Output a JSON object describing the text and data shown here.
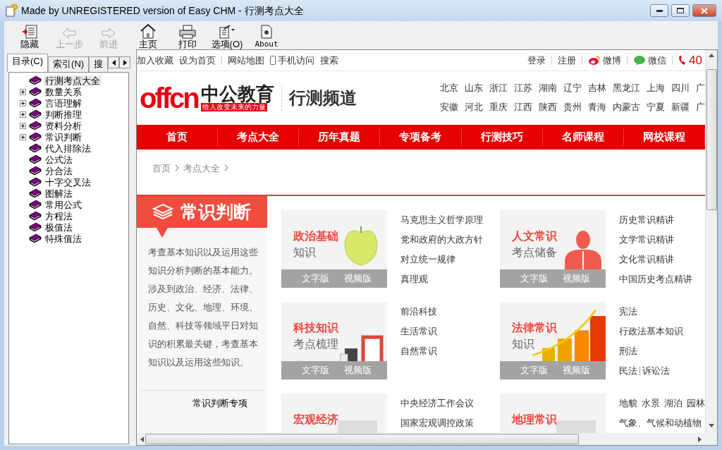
{
  "window": {
    "title": "Made by UNREGISTERED version of Easy CHM - 行测考点大全"
  },
  "toolbar": [
    {
      "label": "隐藏",
      "kind": "hide",
      "disabled": false
    },
    {
      "label": "上一步",
      "kind": "back",
      "disabled": true
    },
    {
      "label": "前进",
      "kind": "forward",
      "disabled": true
    },
    {
      "label": "主页",
      "kind": "home",
      "disabled": false
    },
    {
      "label": "打印",
      "kind": "print",
      "disabled": false
    },
    {
      "label": "选项(O)",
      "kind": "options",
      "disabled": false
    },
    {
      "label": "About",
      "kind": "about",
      "disabled": false
    }
  ],
  "nav_tabs": [
    {
      "label": "目录(C)",
      "selected": true
    },
    {
      "label": "索引(N)",
      "selected": false
    },
    {
      "label": "搜",
      "selected": false
    }
  ],
  "tree": [
    {
      "label": "行测考点大全",
      "kind": "page",
      "selected": true
    },
    {
      "label": "数量关系",
      "kind": "folder",
      "expanded": false,
      "selected": false
    },
    {
      "label": "言语理解",
      "kind": "folder",
      "expanded": false,
      "selected": false
    },
    {
      "label": "判断推理",
      "kind": "folder",
      "expanded": false,
      "selected": false
    },
    {
      "label": "资料分析",
      "kind": "folder",
      "expanded": false,
      "selected": false
    },
    {
      "label": "常识判断",
      "kind": "folder",
      "expanded": false,
      "selected": false
    },
    {
      "label": "代入排除法",
      "kind": "page",
      "selected": false
    },
    {
      "label": "公式法",
      "kind": "page",
      "selected": false
    },
    {
      "label": "分合法",
      "kind": "page",
      "selected": false
    },
    {
      "label": "十字交叉法",
      "kind": "page",
      "selected": false
    },
    {
      "label": "图解法",
      "kind": "page",
      "selected": false
    },
    {
      "label": "常用公式",
      "kind": "page",
      "selected": false
    },
    {
      "label": "方程法",
      "kind": "page",
      "selected": false
    },
    {
      "label": "极值法",
      "kind": "page",
      "selected": false
    },
    {
      "label": "特殊值法",
      "kind": "page",
      "selected": false
    }
  ],
  "web": {
    "top_links_left": [
      {
        "label": "加入收藏",
        "kind": "text"
      },
      {
        "label": "设为首页",
        "kind": "text"
      },
      {
        "label": "网站地图",
        "kind": "text"
      },
      {
        "label": "手机访问",
        "kind": "phone"
      },
      {
        "label": "搜索",
        "kind": "text"
      }
    ],
    "top_links_right": [
      {
        "label": "登录",
        "kind": "text"
      },
      {
        "label": "注册",
        "kind": "text"
      },
      {
        "label": "微博",
        "kind": "weibo"
      },
      {
        "label": "微信",
        "kind": "wechat"
      },
      {
        "label": "40",
        "kind": "hotline"
      }
    ],
    "logo": {
      "mark": "offcn",
      "name": "中公教育",
      "slogan": "给人改变未来的力量"
    },
    "channel": "行测频道",
    "cities": [
      [
        "北京",
        "山东",
        "浙江",
        "江苏",
        "湖南",
        "辽宁",
        "吉林",
        "黑龙江",
        "上海",
        "四川",
        "广"
      ],
      [
        "安徽",
        "河北",
        "重庆",
        "江西",
        "陕西",
        "贵州",
        "青海",
        "内蒙古",
        "宁夏",
        "新疆",
        "广"
      ]
    ],
    "nav": [
      "首页",
      "考点大全",
      "历年真题",
      "专项备考",
      "行测技巧",
      "名师课程",
      "网校课程"
    ],
    "breadcrumb": [
      "首页",
      "考点大全"
    ],
    "section": {
      "title": "常识判断",
      "description": "考查基本知识以及运用这些知识分析判断的基本能力。涉及到政治、经济、法律、历史、文化、地理、环境、自然、科技等领域平日对知识的积累最关键，考查基本知识以及运用这些知识。",
      "link": "常识判断专项"
    },
    "cards": [
      {
        "title": "政治基础",
        "subtitle": "知识",
        "kind": "apple",
        "buttons": [
          "文字版",
          "视频版"
        ],
        "links": [
          [
            "马克思主义哲学原理"
          ],
          [
            "党和政府的大政方针"
          ],
          [
            "对立统一规律"
          ],
          [
            "真理观"
          ]
        ]
      },
      {
        "title": "人文常识",
        "subtitle": "考点储备",
        "kind": "person",
        "buttons": [
          "文字版",
          "视频版"
        ],
        "links": [
          [
            "历史常识精讲"
          ],
          [
            "文学常识精讲"
          ],
          [
            "文化常识精讲"
          ],
          [
            "中国历史考点精讲"
          ]
        ]
      },
      {
        "title": "科技知识",
        "subtitle": "考点梳理",
        "kind": "books",
        "buttons": [
          "文字版",
          "视频版"
        ],
        "links": [
          [
            "前沿科技"
          ],
          [
            "生活常识"
          ],
          [
            "自然常识"
          ]
        ]
      },
      {
        "title": "法律常识",
        "subtitle": "知识",
        "kind": "growth",
        "buttons": [
          "文字版",
          "视频版"
        ],
        "links": [
          [
            "宪法"
          ],
          [
            "行政法基本知识"
          ],
          [
            "刑法"
          ],
          [
            "民法",
            "诉讼法"
          ]
        ]
      },
      {
        "title": "宏观经济",
        "kind": "photo",
        "links": [
          [
            "中央经济工作会议"
          ],
          [
            "国家宏观调控政策"
          ]
        ]
      },
      {
        "title": "地理常识",
        "kind": "photo",
        "links": [
          [
            "地貌",
            "水景",
            "湖泊",
            "园林"
          ],
          [
            "气象、气候和动植物"
          ]
        ]
      }
    ]
  }
}
